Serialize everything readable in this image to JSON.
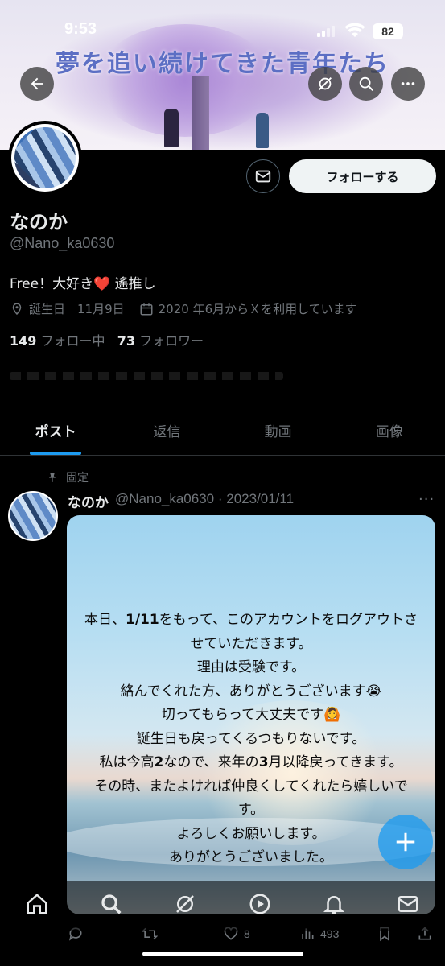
{
  "status_bar": {
    "time": "9:53",
    "battery": "82"
  },
  "banner": {
    "title": "夢を追い続けてきた青年たち"
  },
  "profile": {
    "name": "なのか",
    "handle": "@Nano_ka0630",
    "bio_prefix": "Free！大好き",
    "bio_heart": "❤️",
    "bio_suffix": " 遙推し",
    "birthday": "誕生日　11月9日",
    "joined": "2020 年6月からＸを利用しています",
    "following_count": "149",
    "following_label": " フォロー中",
    "followers_count": "73",
    "followers_label": " フォロワー",
    "follow_button": "フォローする"
  },
  "tabs": [
    {
      "label": "ポスト",
      "active": true
    },
    {
      "label": "返信",
      "active": false
    },
    {
      "label": "動画",
      "active": false
    },
    {
      "label": "画像",
      "active": false
    }
  ],
  "post": {
    "pinned_label": "固定",
    "author": "なのか",
    "meta": "@Nano_ka0630 · 2023/01/11",
    "image_text": {
      "l1a": "本日、",
      "l1b": "1/11",
      "l1c": "をもって、このアカウントをログアウトさ",
      "l2": "せていただきます。",
      "l3": "理由は受験です。",
      "l4": "絡んでくれた方、ありがとうございます😭",
      "l5": "切ってもらって大丈夫です🙆",
      "l6": "誕生日も戻ってくるつもりないです。",
      "l7a": "私は今高",
      "l7b": "2",
      "l7c": "なので、来年の",
      "l7d": "3",
      "l7e": "月以降戻ってきます。",
      "l8": "その時、またよければ仲良くしてくれたら嬉しいで",
      "l9": "す。",
      "l10": "よろしくお願いします。",
      "l11": "ありがとうございました。"
    },
    "likes": "8",
    "views": "493"
  },
  "icons": {
    "back": "back-arrow-icon",
    "slash": "grok-icon",
    "search": "search-icon",
    "more": "more-icon",
    "message": "message-icon"
  }
}
